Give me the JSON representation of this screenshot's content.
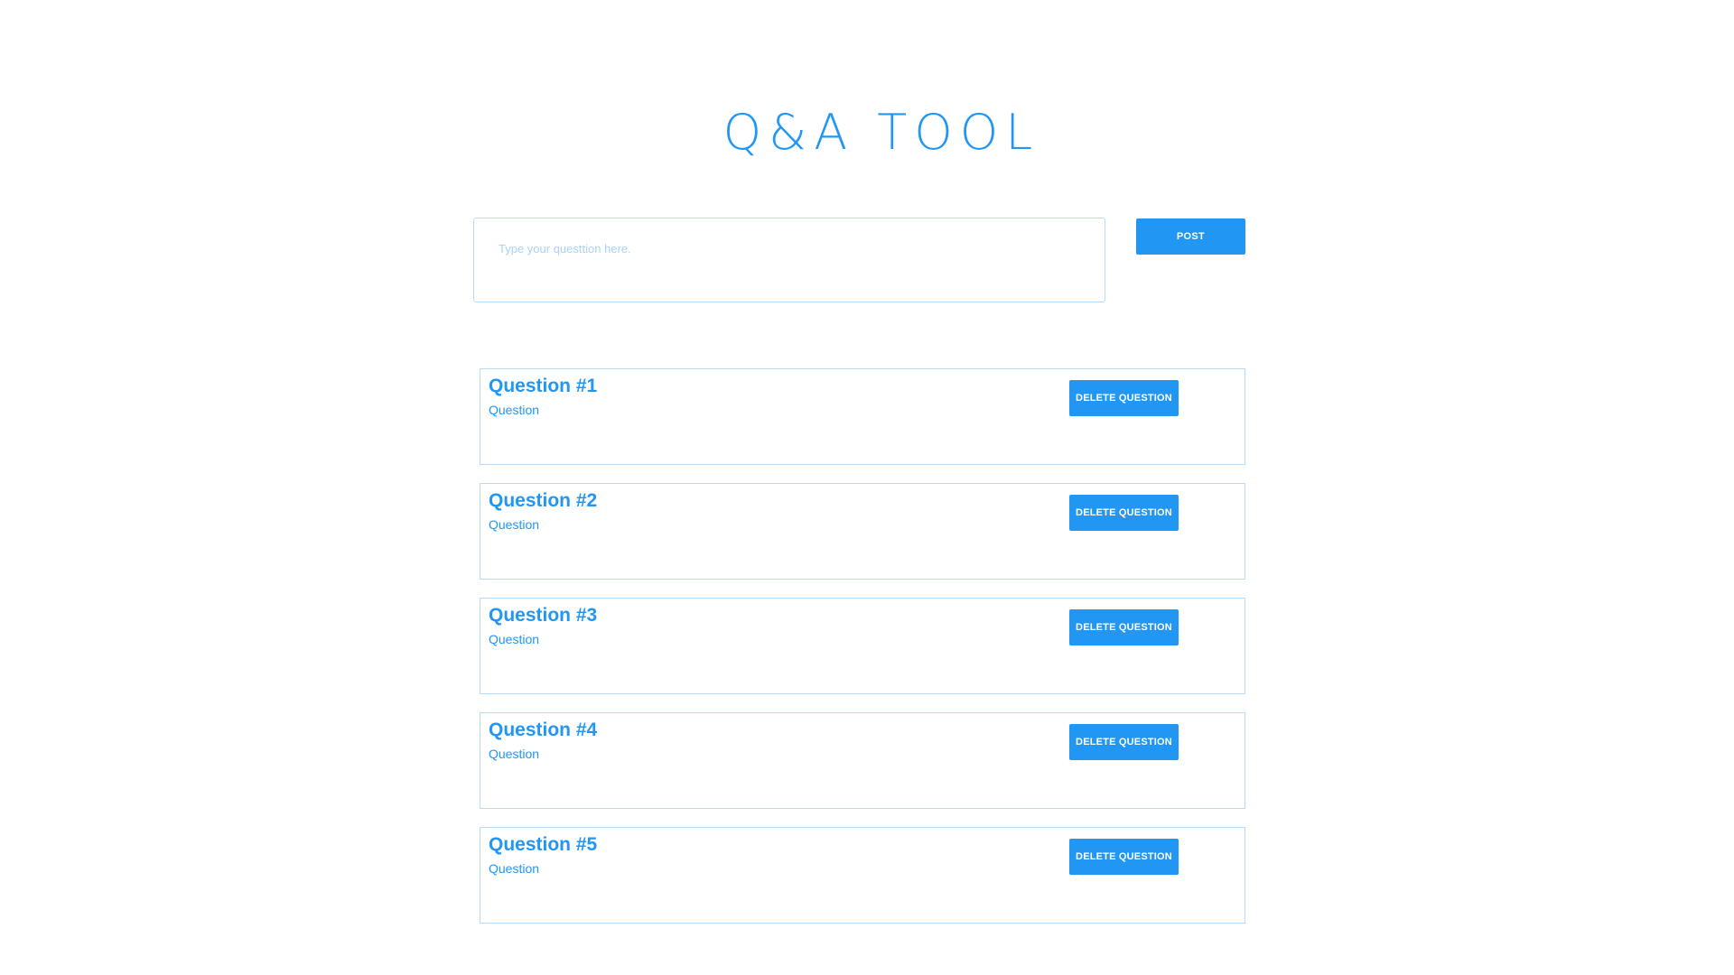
{
  "header": {
    "title": "Q&A TOOL"
  },
  "composer": {
    "placeholder": "Type your questtion here.",
    "value": "",
    "post_label": "POST"
  },
  "questions": [
    {
      "title": "Question #1",
      "text": "Question",
      "delete_label": "DELETE QUESTION"
    },
    {
      "title": "Question #2",
      "text": "Question",
      "delete_label": "DELETE QUESTION"
    },
    {
      "title": "Question #3",
      "text": "Question",
      "delete_label": "DELETE QUESTION"
    },
    {
      "title": "Question #4",
      "text": "Question",
      "delete_label": "DELETE QUESTION"
    },
    {
      "title": "Question #5",
      "text": "Question",
      "delete_label": "DELETE QUESTION"
    }
  ],
  "colors": {
    "accent": "#2196f3",
    "border": "#b9dbfa",
    "placeholder": "#a8d2f6",
    "background": "#ffffff"
  }
}
